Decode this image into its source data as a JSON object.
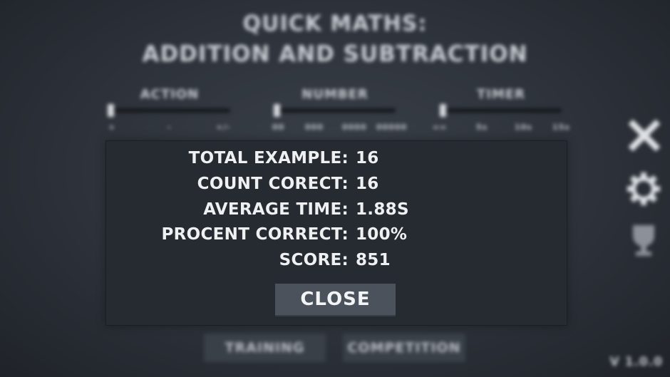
{
  "background": {
    "title_line1": "QUICK MATHS:",
    "title_line2": "ADDITION AND SUBTRACTION",
    "settings": [
      {
        "label": "ACTION",
        "ticks": [
          "+",
          "-",
          "+/-"
        ],
        "level": 0
      },
      {
        "label": "NUMBER",
        "ticks": [
          "00",
          "000",
          "0000",
          "00000"
        ],
        "level": 0
      },
      {
        "label": "TIMER",
        "ticks": [
          "∞∞",
          "5s",
          "10s",
          "15s"
        ],
        "level": 0
      }
    ],
    "side_icons": [
      "close-icon",
      "gear-icon",
      "trophy-icon"
    ],
    "buttons": {
      "training": "TRAINING",
      "competition": "COMPETITION"
    },
    "version": "V 1.0.0"
  },
  "results": {
    "rows": [
      {
        "label": "TOTAL EXAMPLE:",
        "value": "16"
      },
      {
        "label": "COUNT CORECT:",
        "value": "16"
      },
      {
        "label": "AVERAGE TIME:",
        "value": "1.88S"
      },
      {
        "label": "PROCENT CORRECT:",
        "value": "100%"
      },
      {
        "label": "SCORE:",
        "value": "851"
      }
    ],
    "close_label": "CLOSE"
  },
  "colors": {
    "background": "#2d323a",
    "panel": "#262a31",
    "button": "#4b525c",
    "text": "#eef0f2"
  }
}
